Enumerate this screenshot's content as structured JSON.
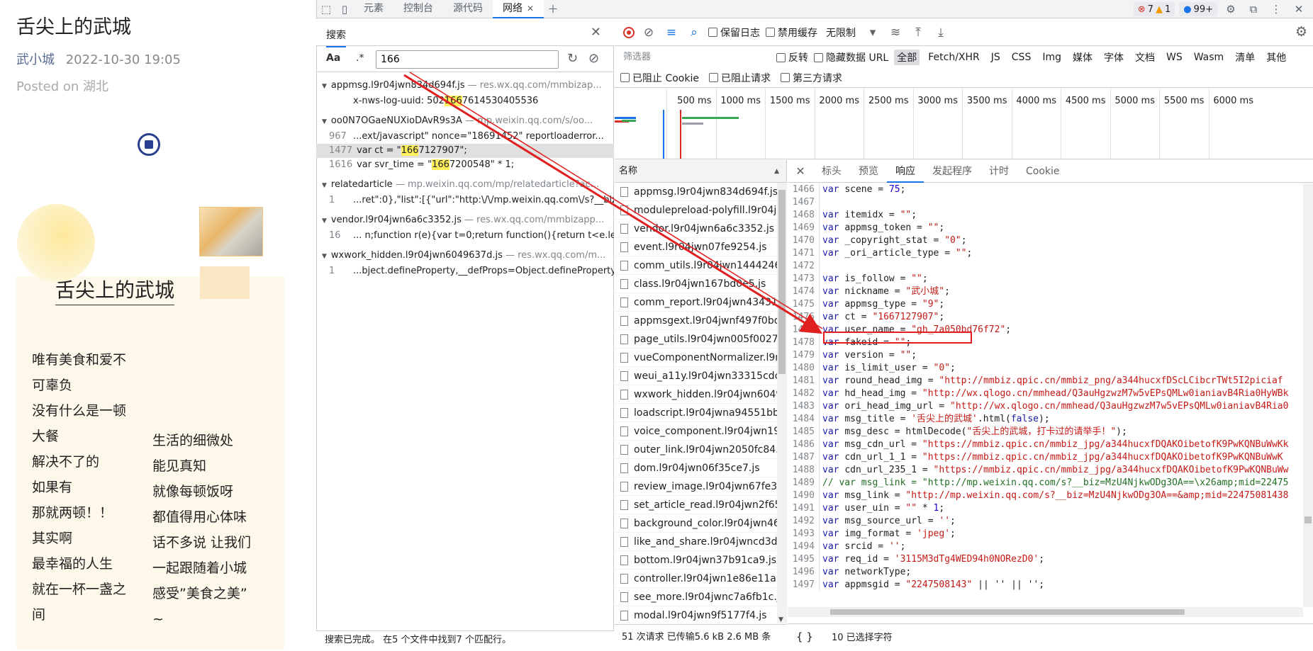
{
  "article": {
    "title": "舌尖上的武城",
    "author": "武小城",
    "datetime": "2022-10-30 19:05",
    "posted": "Posted on 湖北",
    "heading": "舌尖上的武城",
    "poem_left": [
      "唯有美食和爱不",
      "可辜负",
      "没有什么是一顿",
      "大餐",
      "解决不了的",
      "如果有",
      "那就两顿！！",
      "其实啊",
      "最幸福的人生",
      "就在一杯一盏之",
      "间"
    ],
    "poem_right": [
      "生活的细微处",
      "能见真知",
      "就像每顿饭呀",
      "都值得用心体味",
      "话不多说 让我们",
      "一起跟随着小城",
      "感受”美食之美”",
      "~"
    ]
  },
  "devtools": {
    "tabs": [
      "元素",
      "控制台",
      "源代码",
      "网络"
    ],
    "badges": {
      "errors": "7",
      "warnings": "1",
      "info": "99+"
    }
  },
  "search": {
    "tab_label": "搜索",
    "aa_label": "Aa",
    "regex_label": ".*",
    "query": "166",
    "status": "搜索已完成。 在5 个文件中找到7 个匹配行。",
    "files": [
      {
        "name": "appmsg.l9r04jwn834d694f.js",
        "source": " — res.wx.qq.com/mmbizap...",
        "lines": [
          {
            "ln": "",
            "pre": "x-nws-log-uuid:  502",
            "hit": "166",
            "post": "7614530405536",
            "sel": false
          }
        ]
      },
      {
        "name": "oo0N7OGaeNUXioDAvR9s3A",
        "source": " — mp.weixin.qq.com/s/oo...",
        "lines": [
          {
            "ln": "967",
            "pre": "...ext/javascript\" nonce=\"18691452",
            "hit": "",
            "post": "\" reportloaderror...",
            "sel": false
          },
          {
            "ln": "1477",
            "pre": "var ct = \"",
            "hit": "166",
            "post": "7127907\";",
            "sel": true
          },
          {
            "ln": "1616",
            "pre": "var svr_time = \"",
            "hit": "166",
            "post": "7200548\" * 1;",
            "sel": false
          }
        ]
      },
      {
        "name": "relatedarticle",
        "source": " — mp.weixin.qq.com/mp/relatedarticle?ac...",
        "lines": [
          {
            "ln": "1",
            "pre": "...ret\":0},\"list\":[{\"url\":\"http:\\/\\/mp.weixin.qq.com\\/s?__biz...",
            "hit": "",
            "post": "",
            "sel": false
          }
        ]
      },
      {
        "name": "vendor.l9r04jwn6a6c3352.js",
        "source": " — res.wx.qq.com/mmbizapp...",
        "lines": [
          {
            "ln": "16",
            "pre": "... n;function r(e){var t=0;return function(){return t<e.le...",
            "hit": "",
            "post": "",
            "sel": false
          }
        ]
      },
      {
        "name": "wxwork_hidden.l9r04jwn6049637d.js",
        "source": " — res.wx.qq.com/m...",
        "lines": [
          {
            "ln": "1",
            "pre": "...bject.defineProperty,__defProps=Object.defineProperty...",
            "hit": "",
            "post": "",
            "sel": false
          }
        ]
      }
    ]
  },
  "network": {
    "toolbar": {
      "preserve_log": "保留日志",
      "disable_cache": "禁用缓存",
      "throttle": "无限制"
    },
    "filter": {
      "placeholder": "筛选器",
      "invert": "反转",
      "hide_data_url": "隐藏数据 URL",
      "types": [
        "全部",
        "Fetch/XHR",
        "JS",
        "CSS",
        "Img",
        "媒体",
        "字体",
        "文档",
        "WS",
        "Wasm",
        "清单",
        "其他"
      ],
      "blocked_cookie": "已阻止 Cookie",
      "blocked_request": "已阻止请求",
      "third_party": "第三方请求"
    },
    "timeline_ticks": [
      "500 ms",
      "1000 ms",
      "1500 ms",
      "2000 ms",
      "2500 ms",
      "3000 ms",
      "3500 ms",
      "4000 ms",
      "4500 ms",
      "5000 ms",
      "5500 ms",
      "6000 ms"
    ],
    "name_header": "名称",
    "requests": [
      "appmsg.l9r04jwn834d694f.js",
      "modulepreload-polyfill.l9r04j",
      "vendor.l9r04jwn6a6c3352.js",
      "event.l9r04jwn07fe9254.js",
      "comm_utils.l9r04jwn1444246.",
      "class.l9r04jwn167bd0e5.js",
      "comm_report.l9r04jwn4343166",
      "appmsgext.l9r04jwnf497f0bd",
      "page_utils.l9r04jwn005f0027.j",
      "vueComponentNormalizer.l9r",
      "weui_a11y.l9r04jwn33315cdc.",
      "wxwork_hidden.l9r04jwn6049",
      "loadscript.l9r04jwna94551bb",
      "voice_component.l9r04jwn19",
      "outer_link.l9r04jwn2050fc84.j",
      "dom.l9r04jwn06f35ce7.js",
      "review_image.l9r04jwn67fe3b",
      "set_article_read.l9r04jwn2f65.",
      "background_color.l9r04jwn46",
      "like_and_share.l9r04jwncd3dc",
      "bottom.l9r04jwn37b91ca9.js",
      "controller.l9r04jwn1e86e11a.j",
      "see_more.l9r04jwnc7a6fb1c.js",
      "modal.l9r04jwn9f5177f4.js"
    ],
    "status": "51 次请求  已传输5.6 kB  2.6 MB 条",
    "detail_tabs": [
      "标头",
      "预览",
      "响应",
      "发起程序",
      "计时",
      "Cookie"
    ],
    "active_detail_tab": "响应",
    "code_lines": [
      {
        "n": "1466",
        "c": [
          [
            "k",
            "var "
          ],
          [
            "t",
            "scene = "
          ],
          [
            "n",
            "75"
          ],
          [
            "t",
            ";"
          ]
        ]
      },
      {
        "n": "1467",
        "c": []
      },
      {
        "n": "1468",
        "c": [
          [
            "k",
            "var "
          ],
          [
            "t",
            "itemidx = "
          ],
          [
            "s",
            "\"\""
          ],
          [
            "t",
            ";"
          ]
        ]
      },
      {
        "n": "1469",
        "c": [
          [
            "k",
            "var "
          ],
          [
            "t",
            "appmsg_token = "
          ],
          [
            "s",
            "\"\""
          ],
          [
            "t",
            ";"
          ]
        ]
      },
      {
        "n": "1470",
        "c": [
          [
            "k",
            "var "
          ],
          [
            "t",
            "_copyright_stat = "
          ],
          [
            "s",
            "\"0\""
          ],
          [
            "t",
            ";"
          ]
        ]
      },
      {
        "n": "1471",
        "c": [
          [
            "k",
            "var "
          ],
          [
            "t",
            "_ori_article_type = "
          ],
          [
            "s",
            "\"\""
          ],
          [
            "t",
            ";"
          ]
        ]
      },
      {
        "n": "1472",
        "c": []
      },
      {
        "n": "1473",
        "c": [
          [
            "k",
            "var "
          ],
          [
            "t",
            "is_follow = "
          ],
          [
            "s",
            "\"\""
          ],
          [
            "t",
            ";"
          ]
        ]
      },
      {
        "n": "1474",
        "c": [
          [
            "k",
            "var "
          ],
          [
            "t",
            "nickname = "
          ],
          [
            "s",
            "\"武小城\""
          ],
          [
            "t",
            ";"
          ]
        ]
      },
      {
        "n": "1475",
        "c": [
          [
            "k",
            "var "
          ],
          [
            "t",
            "appmsg_type = "
          ],
          [
            "s",
            "\"9\""
          ],
          [
            "t",
            ";"
          ]
        ]
      },
      {
        "n": "1476",
        "c": [
          [
            "k",
            "var "
          ],
          [
            "t",
            "ct = "
          ],
          [
            "s",
            "\"1667127907\""
          ],
          [
            "t",
            ";"
          ]
        ],
        "boxed": true
      },
      {
        "n": "1477",
        "c": [
          [
            "k",
            "var "
          ],
          [
            "t",
            "user_name = "
          ],
          [
            "s",
            "\"gh_7a050bd76f72\""
          ],
          [
            "t",
            ";"
          ]
        ]
      },
      {
        "n": "1478",
        "c": [
          [
            "k",
            "var "
          ],
          [
            "t",
            "fakeid = "
          ],
          [
            "s",
            "\"\""
          ],
          [
            "t",
            ";"
          ]
        ]
      },
      {
        "n": "1479",
        "c": [
          [
            "k",
            "var "
          ],
          [
            "t",
            "version = "
          ],
          [
            "s",
            "\"\""
          ],
          [
            "t",
            ";"
          ]
        ]
      },
      {
        "n": "1480",
        "c": [
          [
            "k",
            "var "
          ],
          [
            "t",
            "is_limit_user = "
          ],
          [
            "s",
            "\"0\""
          ],
          [
            "t",
            ";"
          ]
        ]
      },
      {
        "n": "1481",
        "c": [
          [
            "k",
            "var "
          ],
          [
            "t",
            "round_head_img = "
          ],
          [
            "s",
            "\"http://mmbiz.qpic.cn/mmbiz_png/a344hucxfDScLCibcrTWt5I2piciaf"
          ]
        ]
      },
      {
        "n": "1482",
        "c": [
          [
            "k",
            "var "
          ],
          [
            "t",
            "hd_head_img = "
          ],
          [
            "s",
            "\"http://wx.qlogo.cn/mmhead/Q3auHgzwzM7w5vEPsQMLw0ianiavB4Ria0HyWBk"
          ]
        ]
      },
      {
        "n": "1483",
        "c": [
          [
            "k",
            "var "
          ],
          [
            "t",
            "ori_head_img_url = "
          ],
          [
            "s",
            "\"http://wx.qlogo.cn/mmhead/Q3auHgzwzM7w5vEPsQMLw0ianiavB4Ria0"
          ]
        ]
      },
      {
        "n": "1484",
        "c": [
          [
            "k",
            "var "
          ],
          [
            "t",
            "msg_title = "
          ],
          [
            "s",
            "'舌尖上的武城'"
          ],
          [
            "t",
            ".html("
          ],
          [
            "k",
            "false"
          ],
          [
            "t",
            ");"
          ]
        ]
      },
      {
        "n": "1485",
        "c": [
          [
            "k",
            "var "
          ],
          [
            "t",
            "msg_desc = htmlDecode("
          ],
          [
            "s",
            "\"舌尖上的武城，打卡过的请举手！\""
          ],
          [
            "t",
            ");"
          ]
        ]
      },
      {
        "n": "1486",
        "c": [
          [
            "k",
            "var "
          ],
          [
            "t",
            "msg_cdn_url = "
          ],
          [
            "s",
            "\"https://mmbiz.qpic.cn/mmbiz_jpg/a344hucxfDQAKOibetofK9PwKQNBuWwKk"
          ]
        ]
      },
      {
        "n": "1487",
        "c": [
          [
            "k",
            "var "
          ],
          [
            "t",
            "cdn_url_1_1 = "
          ],
          [
            "s",
            "\"https://mmbiz.qpic.cn/mmbiz_jpg/a344hucxfDQAKOibetofK9PwKQNBuWwK"
          ]
        ]
      },
      {
        "n": "1488",
        "c": [
          [
            "k",
            "var "
          ],
          [
            "t",
            "cdn_url_235_1 = "
          ],
          [
            "s",
            "\"https://mmbiz.qpic.cn/mmbiz_jpg/a344hucxfDQAKOibetofK9PwKQNBuWw"
          ]
        ]
      },
      {
        "n": "1489",
        "c": [
          [
            "m",
            "// var msg_link = \"http://mp.weixin.qq.com/s?__biz=MzU4NjkwODg3OA==\\x26amp;mid=22475"
          ]
        ]
      },
      {
        "n": "1490",
        "c": [
          [
            "k",
            "var "
          ],
          [
            "t",
            "msg_link = "
          ],
          [
            "s",
            "\"http://mp.weixin.qq.com/s?__biz=MzU4NjkwODg3OA==&amp;mid=22475081438"
          ]
        ]
      },
      {
        "n": "1491",
        "c": [
          [
            "k",
            "var "
          ],
          [
            "t",
            "user_uin = "
          ],
          [
            "s",
            "\"\""
          ],
          [
            "t",
            " * "
          ],
          [
            "n",
            "1"
          ],
          [
            "t",
            ";"
          ]
        ]
      },
      {
        "n": "1492",
        "c": [
          [
            "k",
            "var "
          ],
          [
            "t",
            "msg_source_url = "
          ],
          [
            "s",
            "''"
          ],
          [
            "t",
            ";"
          ]
        ]
      },
      {
        "n": "1493",
        "c": [
          [
            "k",
            "var "
          ],
          [
            "t",
            "img_format = "
          ],
          [
            "s",
            "'jpeg'"
          ],
          [
            "t",
            ";"
          ]
        ]
      },
      {
        "n": "1494",
        "c": [
          [
            "k",
            "var "
          ],
          [
            "t",
            "srcid = "
          ],
          [
            "s",
            "''"
          ],
          [
            "t",
            ";"
          ]
        ]
      },
      {
        "n": "1495",
        "c": [
          [
            "k",
            "var "
          ],
          [
            "t",
            "req_id = "
          ],
          [
            "s",
            "'3115M3dTg4WED94h0NORezD0'"
          ],
          [
            "t",
            ";"
          ]
        ]
      },
      {
        "n": "1496",
        "c": [
          [
            "k",
            "var "
          ],
          [
            "t",
            "networkType;"
          ]
        ]
      },
      {
        "n": "1497",
        "c": [
          [
            "k",
            "var "
          ],
          [
            "t",
            "appmsgid = "
          ],
          [
            "s",
            "\"2247508143\""
          ],
          [
            "t",
            " || '' || '';"
          ]
        ]
      }
    ],
    "detail_footer": {
      "braces": "{ }",
      "selected": "10 已选择字符"
    }
  }
}
